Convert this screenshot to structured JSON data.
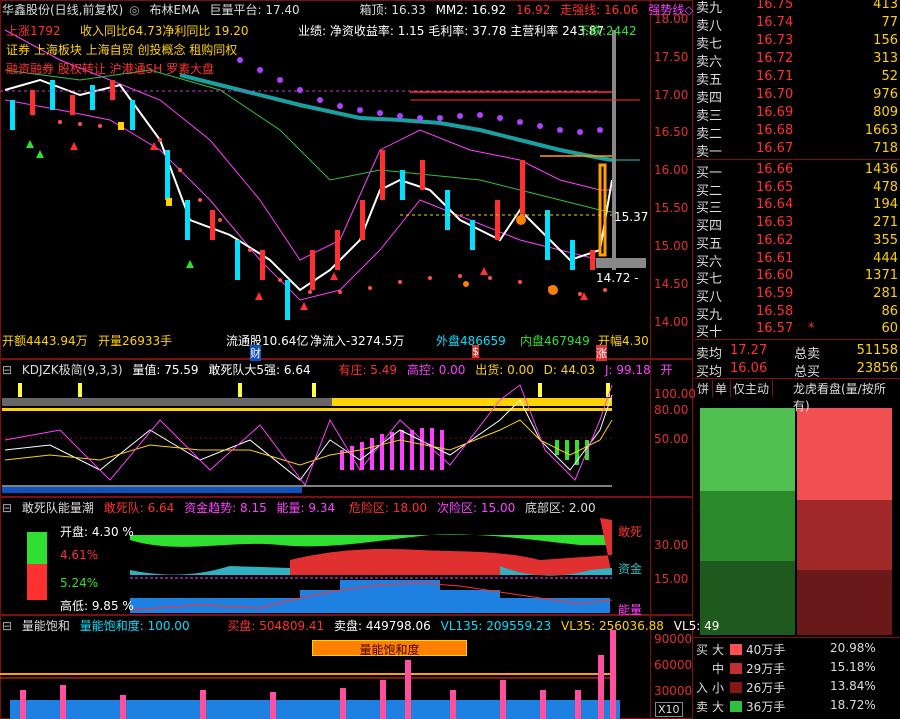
{
  "colors": {
    "up": "#ff3030",
    "down": "#00e0ff",
    "yellow": "#ffd200",
    "magenta": "#ff40ff",
    "green": "#30e030",
    "white": "#ffffff",
    "gray": "#888888"
  },
  "kline": {
    "header": {
      "stock": "华鑫股份(日线,前复权)",
      "ind": "布林EMA",
      "giant": "巨量平台: 17.40",
      "box": "箱顶: 16.33",
      "mm2": "MM2: 16.92",
      "mm2b": "16.92",
      "trend": "走强线: 16.06",
      "strong": "强势线◇"
    },
    "line2": {
      "shares": "上涨1792",
      "income": "收入同比64.73净利同比 19.20",
      "perf": "业绩: 净资收益率: 1.15 毛利率: 37.78 主营利率 243.87",
      "drop": "下跌:2442"
    },
    "concepts1": "证券 上海板块 上海自贸 创投概念 租购同权",
    "concepts2": "融资融券 股权转让 沪港通SH 罗素大盘",
    "bottom": {
      "amount": "开额4443.94万",
      "open": "开量26933手",
      "float": "流通股10.64亿",
      "netflow": "净流入-3274.5万",
      "outer": "外盘486659",
      "inner": "内盘467949",
      "amp": "开幅4.30"
    },
    "markers": {
      "cai": "财",
      "shu": "$",
      "zhang": "涨"
    },
    "curlabel": "15.37",
    "lowlabel": "14.72 -",
    "yticks": [
      "18.00",
      "17.50",
      "17.00",
      "16.50",
      "16.00",
      "15.50",
      "15.00",
      "14.50",
      "14.00"
    ]
  },
  "kdj": {
    "header": {
      "name": "KDJZK极简(9,3,3)",
      "qty": "量值: 75.59",
      "dare": "敢死队大5强: 6.64",
      "top": "有庄: 5.49",
      "hi": "高控: 0.00",
      "out": "出货: 0.00",
      "d": "D: 44.03",
      "j": "J: 99.18",
      "kai": "开"
    },
    "yticks": [
      "100.00",
      "80.00",
      "50.00"
    ]
  },
  "dare": {
    "header": {
      "name": "敢死队能量潮",
      "dare": "敢死队: 6.64",
      "fund": "资金趋势: 8.15",
      "energy": "能量: 9.34",
      "risk": "危险区: 18.00",
      "risk2": "次险区: 15.00",
      "bottom": "底部区: 2.00"
    },
    "box": {
      "open": "开盘: 4.30 %",
      "up": "4.61%",
      "down": "5.24%",
      "high": "高低: 9.85 %"
    },
    "tags": {
      "t1": "敢死",
      "t2": "资金",
      "t3": "能量"
    },
    "yticks": [
      "30.00",
      "15.00"
    ]
  },
  "vol": {
    "header": {
      "name": "量能饱和",
      "sat": "量能饱和度: 100.00",
      "buy": "买盘: 504809.41",
      "sell": "卖盘: 449798.06",
      "vl135": "VL135: 209559.23",
      "vl35": "VL35: 256036.88",
      "vl5": "VL5: 49"
    },
    "banner": "量能饱和度",
    "yticks": [
      "90000",
      "60000",
      "30000"
    ],
    "scale": "X10"
  },
  "quotes": {
    "sell": [
      {
        "n": "卖九",
        "p": "16.75",
        "v": "413"
      },
      {
        "n": "卖八",
        "p": "16.74",
        "v": "77"
      },
      {
        "n": "卖七",
        "p": "16.73",
        "v": "156"
      },
      {
        "n": "卖六",
        "p": "16.72",
        "v": "313"
      },
      {
        "n": "卖五",
        "p": "16.71",
        "v": "52"
      },
      {
        "n": "卖四",
        "p": "16.70",
        "v": "976"
      },
      {
        "n": "卖三",
        "p": "16.69",
        "v": "809"
      },
      {
        "n": "卖二",
        "p": "16.68",
        "v": "1663"
      },
      {
        "n": "卖一",
        "p": "16.67",
        "v": "718"
      }
    ],
    "buy": [
      {
        "n": "买一",
        "p": "16.66",
        "v": "1436"
      },
      {
        "n": "买二",
        "p": "16.65",
        "v": "478"
      },
      {
        "n": "买三",
        "p": "16.64",
        "v": "194"
      },
      {
        "n": "买四",
        "p": "16.63",
        "v": "271"
      },
      {
        "n": "买五",
        "p": "16.62",
        "v": "355"
      },
      {
        "n": "买六",
        "p": "16.61",
        "v": "444"
      },
      {
        "n": "买七",
        "p": "16.60",
        "v": "1371"
      },
      {
        "n": "买八",
        "p": "16.59",
        "v": "281"
      },
      {
        "n": "买九",
        "p": "16.58",
        "v": "86"
      },
      {
        "n": "买十",
        "p": "16.57",
        "v": "60",
        "mark": "*"
      }
    ],
    "avg": [
      {
        "n": "卖均",
        "p": "17.27",
        "k": "总卖",
        "v": "51158"
      },
      {
        "n": "买均",
        "p": "16.06",
        "k": "总买",
        "v": "23856"
      }
    ]
  },
  "tabs": [
    "饼",
    "单",
    "仅主动",
    "龙虎看盘(量/按所有)"
  ],
  "flows": [
    {
      "side": "买",
      "size": "大",
      "amt": "40万手",
      "pct": "20.98%",
      "color": "#ff5050"
    },
    {
      "side": "",
      "size": "中",
      "amt": "29万手",
      "pct": "15.18%",
      "color": "#c03030"
    },
    {
      "side": "入",
      "size": "小",
      "amt": "26万手",
      "pct": "13.84%",
      "color": "#801818"
    },
    {
      "side": "卖",
      "size": "大",
      "amt": "36万手",
      "pct": "18.72%",
      "color": "#30c040"
    }
  ]
}
